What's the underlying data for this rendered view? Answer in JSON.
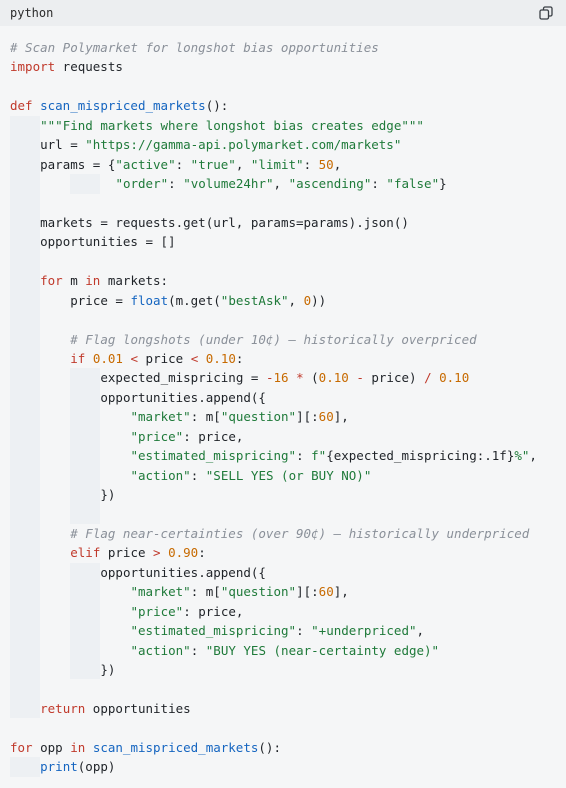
{
  "header": {
    "language": "python",
    "copy_icon": "copy-icon"
  },
  "code_lines": [
    [
      {
        "t": "cm",
        "s": "# Scan Polymarket for longshot bias opportunities"
      }
    ],
    [
      {
        "t": "kw",
        "s": "import"
      },
      {
        "t": "tx",
        "s": " requests"
      }
    ],
    [],
    [
      {
        "t": "kw",
        "s": "def"
      },
      {
        "t": "tx",
        "s": " "
      },
      {
        "t": "fn",
        "s": "scan_mispriced_markets"
      },
      {
        "t": "tx",
        "s": "():"
      }
    ],
    [
      {
        "t": "ind",
        "s": "    "
      },
      {
        "t": "str",
        "s": "\"\"\"Find markets where longshot bias creates edge\"\"\""
      }
    ],
    [
      {
        "t": "ind",
        "s": "    "
      },
      {
        "t": "tx",
        "s": "url = "
      },
      {
        "t": "str",
        "s": "\"https://gamma-api.polymarket.com/markets\""
      }
    ],
    [
      {
        "t": "ind",
        "s": "    "
      },
      {
        "t": "tx",
        "s": "params = {"
      },
      {
        "t": "str",
        "s": "\"active\""
      },
      {
        "t": "tx",
        "s": ": "
      },
      {
        "t": "str",
        "s": "\"true\""
      },
      {
        "t": "tx",
        "s": ", "
      },
      {
        "t": "str",
        "s": "\"limit\""
      },
      {
        "t": "tx",
        "s": ": "
      },
      {
        "t": "num",
        "s": "50"
      },
      {
        "t": "tx",
        "s": ","
      }
    ],
    [
      {
        "t": "ind",
        "s": "              "
      },
      {
        "t": "str",
        "s": "\"order\""
      },
      {
        "t": "tx",
        "s": ": "
      },
      {
        "t": "str",
        "s": "\"volume24hr\""
      },
      {
        "t": "tx",
        "s": ", "
      },
      {
        "t": "str",
        "s": "\"ascending\""
      },
      {
        "t": "tx",
        "s": ": "
      },
      {
        "t": "str",
        "s": "\"false\""
      },
      {
        "t": "tx",
        "s": "}"
      }
    ],
    [
      {
        "t": "ind",
        "s": "    "
      }
    ],
    [
      {
        "t": "ind",
        "s": "    "
      },
      {
        "t": "tx",
        "s": "markets = requests.get(url, params=params).json()"
      }
    ],
    [
      {
        "t": "ind",
        "s": "    "
      },
      {
        "t": "tx",
        "s": "opportunities = []"
      }
    ],
    [
      {
        "t": "ind",
        "s": "    "
      }
    ],
    [
      {
        "t": "ind",
        "s": "    "
      },
      {
        "t": "kw",
        "s": "for"
      },
      {
        "t": "tx",
        "s": " m "
      },
      {
        "t": "kw",
        "s": "in"
      },
      {
        "t": "tx",
        "s": " markets:"
      }
    ],
    [
      {
        "t": "ind",
        "s": "        "
      },
      {
        "t": "tx",
        "s": "price = "
      },
      {
        "t": "fn",
        "s": "float"
      },
      {
        "t": "tx",
        "s": "(m.get("
      },
      {
        "t": "str",
        "s": "\"bestAsk\""
      },
      {
        "t": "tx",
        "s": ", "
      },
      {
        "t": "num",
        "s": "0"
      },
      {
        "t": "tx",
        "s": "))"
      }
    ],
    [
      {
        "t": "ind",
        "s": "        "
      }
    ],
    [
      {
        "t": "ind",
        "s": "        "
      },
      {
        "t": "cm",
        "s": "# Flag longshots (under 10¢) — historically overpriced"
      }
    ],
    [
      {
        "t": "ind",
        "s": "        "
      },
      {
        "t": "kw",
        "s": "if"
      },
      {
        "t": "tx",
        "s": " "
      },
      {
        "t": "num",
        "s": "0.01"
      },
      {
        "t": "tx",
        "s": " "
      },
      {
        "t": "op",
        "s": "<"
      },
      {
        "t": "tx",
        "s": " price "
      },
      {
        "t": "op",
        "s": "<"
      },
      {
        "t": "tx",
        "s": " "
      },
      {
        "t": "num",
        "s": "0.10"
      },
      {
        "t": "tx",
        "s": ":"
      }
    ],
    [
      {
        "t": "ind",
        "s": "            "
      },
      {
        "t": "tx",
        "s": "expected_mispricing = "
      },
      {
        "t": "op",
        "s": "-"
      },
      {
        "t": "num",
        "s": "16"
      },
      {
        "t": "tx",
        "s": " "
      },
      {
        "t": "op",
        "s": "*"
      },
      {
        "t": "tx",
        "s": " ("
      },
      {
        "t": "num",
        "s": "0.10"
      },
      {
        "t": "tx",
        "s": " "
      },
      {
        "t": "op",
        "s": "-"
      },
      {
        "t": "tx",
        "s": " price) "
      },
      {
        "t": "op",
        "s": "/"
      },
      {
        "t": "tx",
        "s": " "
      },
      {
        "t": "num",
        "s": "0.10"
      }
    ],
    [
      {
        "t": "ind",
        "s": "            "
      },
      {
        "t": "tx",
        "s": "opportunities.append({"
      }
    ],
    [
      {
        "t": "ind",
        "s": "                "
      },
      {
        "t": "str",
        "s": "\"market\""
      },
      {
        "t": "tx",
        "s": ": m["
      },
      {
        "t": "str",
        "s": "\"question\""
      },
      {
        "t": "tx",
        "s": "][:"
      },
      {
        "t": "num",
        "s": "60"
      },
      {
        "t": "tx",
        "s": "],"
      }
    ],
    [
      {
        "t": "ind",
        "s": "                "
      },
      {
        "t": "str",
        "s": "\"price\""
      },
      {
        "t": "tx",
        "s": ": price,"
      }
    ],
    [
      {
        "t": "ind",
        "s": "                "
      },
      {
        "t": "str",
        "s": "\"estimated_mispricing\""
      },
      {
        "t": "tx",
        "s": ": "
      },
      {
        "t": "str",
        "s": "f\""
      },
      {
        "t": "tx",
        "s": "{expected_mispricing:.1f}"
      },
      {
        "t": "str",
        "s": "%\""
      },
      {
        "t": "tx",
        "s": ","
      }
    ],
    [
      {
        "t": "ind",
        "s": "                "
      },
      {
        "t": "str",
        "s": "\"action\""
      },
      {
        "t": "tx",
        "s": ": "
      },
      {
        "t": "str",
        "s": "\"SELL YES (or BUY NO)\""
      }
    ],
    [
      {
        "t": "ind",
        "s": "            "
      },
      {
        "t": "tx",
        "s": "})"
      }
    ],
    [
      {
        "t": "ind",
        "s": "            "
      }
    ],
    [
      {
        "t": "ind",
        "s": "        "
      },
      {
        "t": "cm",
        "s": "# Flag near-certainties (over 90¢) — historically underpriced"
      }
    ],
    [
      {
        "t": "ind",
        "s": "        "
      },
      {
        "t": "kw",
        "s": "elif"
      },
      {
        "t": "tx",
        "s": " price "
      },
      {
        "t": "op",
        "s": ">"
      },
      {
        "t": "tx",
        "s": " "
      },
      {
        "t": "num",
        "s": "0.90"
      },
      {
        "t": "tx",
        "s": ":"
      }
    ],
    [
      {
        "t": "ind",
        "s": "            "
      },
      {
        "t": "tx",
        "s": "opportunities.append({"
      }
    ],
    [
      {
        "t": "ind",
        "s": "                "
      },
      {
        "t": "str",
        "s": "\"market\""
      },
      {
        "t": "tx",
        "s": ": m["
      },
      {
        "t": "str",
        "s": "\"question\""
      },
      {
        "t": "tx",
        "s": "][:"
      },
      {
        "t": "num",
        "s": "60"
      },
      {
        "t": "tx",
        "s": "],"
      }
    ],
    [
      {
        "t": "ind",
        "s": "                "
      },
      {
        "t": "str",
        "s": "\"price\""
      },
      {
        "t": "tx",
        "s": ": price,"
      }
    ],
    [
      {
        "t": "ind",
        "s": "                "
      },
      {
        "t": "str",
        "s": "\"estimated_mispricing\""
      },
      {
        "t": "tx",
        "s": ": "
      },
      {
        "t": "str",
        "s": "\"+underpriced\""
      },
      {
        "t": "tx",
        "s": ","
      }
    ],
    [
      {
        "t": "ind",
        "s": "                "
      },
      {
        "t": "str",
        "s": "\"action\""
      },
      {
        "t": "tx",
        "s": ": "
      },
      {
        "t": "str",
        "s": "\"BUY YES (near-certainty edge)\""
      }
    ],
    [
      {
        "t": "ind",
        "s": "            "
      },
      {
        "t": "tx",
        "s": "})"
      }
    ],
    [
      {
        "t": "ind",
        "s": "    "
      }
    ],
    [
      {
        "t": "ind",
        "s": "    "
      },
      {
        "t": "kw",
        "s": "return"
      },
      {
        "t": "tx",
        "s": " opportunities"
      }
    ],
    [],
    [
      {
        "t": "kw",
        "s": "for"
      },
      {
        "t": "tx",
        "s": " opp "
      },
      {
        "t": "kw",
        "s": "in"
      },
      {
        "t": "tx",
        "s": " "
      },
      {
        "t": "fn",
        "s": "scan_mispriced_markets"
      },
      {
        "t": "tx",
        "s": "():"
      }
    ],
    [
      {
        "t": "ind",
        "s": "    "
      },
      {
        "t": "fn",
        "s": "print"
      },
      {
        "t": "tx",
        "s": "(opp)"
      }
    ]
  ]
}
